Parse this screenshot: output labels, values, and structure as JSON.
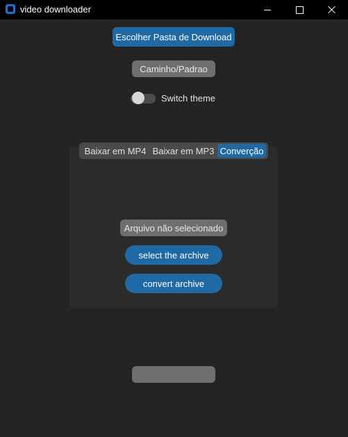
{
  "window": {
    "title": "video downloader",
    "icons": {
      "app": "app-icon",
      "minimize": "minimize-icon",
      "maximize": "maximize-icon",
      "close": "close-icon"
    }
  },
  "main": {
    "choose_folder_label": "Escolher Pasta de Download",
    "path_label": "Caminho/Padrao",
    "theme_switch": {
      "label": "Switch theme",
      "on": false
    }
  },
  "tabs": {
    "items": [
      "Baixar em MP4",
      "Baixar em MP3",
      "Converção"
    ],
    "selected": "Converção"
  },
  "conversion": {
    "file_status": "Arquivo não selecionado",
    "select_label": "select the archive",
    "convert_label": "convert archive"
  },
  "footer": {
    "status_label": ""
  },
  "colors": {
    "background": "#242424",
    "frame": "#2b2b2b",
    "accent": "#1f6aa5",
    "label_gray": "#6f6f6f",
    "titlebar": "#000000"
  }
}
